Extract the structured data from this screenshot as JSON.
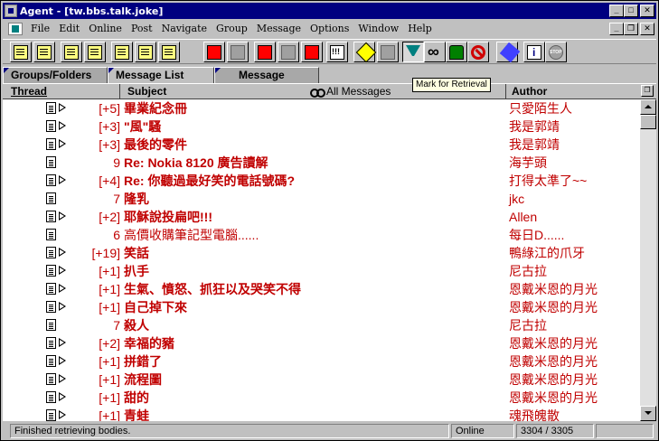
{
  "window": {
    "title": "Agent - [tw.bbs.talk.joke]"
  },
  "window_buttons": {
    "minimize": "_",
    "maximize": "□",
    "close": "✕",
    "restore": "❐"
  },
  "menu": [
    "File",
    "Edit",
    "Online",
    "Post",
    "Navigate",
    "Group",
    "Message",
    "Options",
    "Window",
    "Help"
  ],
  "toolbar": {
    "tooltip": "Mark for Retrieval",
    "buttons": [
      {
        "icon": "groups-icon"
      },
      {
        "icon": "compose-icon"
      },
      {
        "icon": "select-icon"
      },
      {
        "icon": "new-message-icon"
      },
      {
        "icon": "reply-icon"
      },
      {
        "icon": "new-folder-icon"
      },
      {
        "icon": "reply-email-icon"
      },
      {
        "icon": "mark-red-icon"
      },
      {
        "icon": "mark-gray-icon"
      },
      {
        "icon": "forward-icon"
      },
      {
        "icon": "copy-icon"
      },
      {
        "icon": "send-icon"
      },
      {
        "icon": "important-icon"
      },
      {
        "icon": "mark-read-icon"
      },
      {
        "icon": "flag-icon"
      },
      {
        "icon": "retrieve-icon"
      },
      {
        "icon": "watch-icon"
      },
      {
        "icon": "lock-icon"
      },
      {
        "icon": "no-entry-icon"
      },
      {
        "icon": "edit-icon"
      },
      {
        "icon": "info-icon"
      },
      {
        "icon": "stop-icon"
      }
    ]
  },
  "tabs": [
    "Groups/Folders",
    "Message List",
    "Message"
  ],
  "columns": {
    "thread": "Thread",
    "subject": "Subject",
    "filter": "All Messages",
    "author": "Author"
  },
  "messages": [
    {
      "count": "[+5]",
      "subject": "畢業紀念冊",
      "author": "只愛陌生人",
      "thread": true,
      "bold": true
    },
    {
      "count": "[+3]",
      "subject": "\"風\"騷",
      "author": "我是郭靖",
      "thread": true,
      "bold": true
    },
    {
      "count": "[+3]",
      "subject": "最後的零件",
      "author": "我是郭靖",
      "thread": true,
      "bold": true
    },
    {
      "count": "9",
      "subject": "Re: Nokia 8120 廣告讀解",
      "author": "海芋頭",
      "thread": false,
      "bold": true
    },
    {
      "count": "[+4]",
      "subject": "Re: 你聽過最好笑的電話號碼?",
      "author": "打得太準了~~",
      "thread": true,
      "bold": true
    },
    {
      "count": "7",
      "subject": "隆乳",
      "author": "jkc",
      "thread": false,
      "bold": true
    },
    {
      "count": "[+2]",
      "subject": "耶穌說投扁吧!!!",
      "author": "Allen",
      "thread": true,
      "bold": true
    },
    {
      "count": "6",
      "subject": "高價收購筆記型電腦......",
      "author": "每日D......",
      "thread": false,
      "bold": false
    },
    {
      "count": "[+19]",
      "subject": "笑話",
      "author": "鴨綠江的爪牙",
      "thread": true,
      "bold": true
    },
    {
      "count": "[+1]",
      "subject": "扒手",
      "author": "尼古拉",
      "thread": true,
      "bold": true
    },
    {
      "count": "[+1]",
      "subject": "生氣、憤怒、抓狂以及哭笑不得",
      "author": "恩戴米恩的月光",
      "thread": true,
      "bold": true
    },
    {
      "count": "[+1]",
      "subject": "自己掉下來",
      "author": "恩戴米恩的月光",
      "thread": true,
      "bold": true
    },
    {
      "count": "7",
      "subject": "殺人",
      "author": "尼古拉",
      "thread": false,
      "bold": true
    },
    {
      "count": "[+2]",
      "subject": "幸福的豬",
      "author": "恩戴米恩的月光",
      "thread": true,
      "bold": true
    },
    {
      "count": "[+1]",
      "subject": "拼錯了",
      "author": "恩戴米恩的月光",
      "thread": true,
      "bold": true
    },
    {
      "count": "[+1]",
      "subject": "流程圖",
      "author": "恩戴米恩的月光",
      "thread": true,
      "bold": true
    },
    {
      "count": "[+1]",
      "subject": "甜的",
      "author": "恩戴米恩的月光",
      "thread": true,
      "bold": true
    },
    {
      "count": "[+1]",
      "subject": "青蛙",
      "author": "魂飛魄散",
      "thread": true,
      "bold": true
    }
  ],
  "status": {
    "message": "Finished retrieving bodies.",
    "online": "Online",
    "count": "3304 / 3305"
  },
  "colors": {
    "title_bar": "#000080",
    "unread_text": "#c00000",
    "face": "#c0c0c0"
  }
}
